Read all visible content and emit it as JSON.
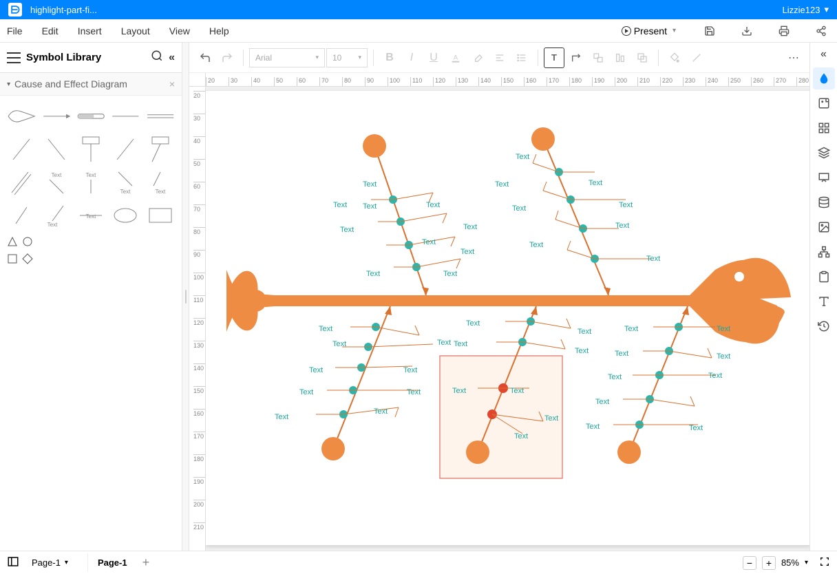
{
  "titlebar": {
    "filename": "highlight-part-fi...",
    "user": "Lizzie123"
  },
  "menubar": {
    "items": [
      "File",
      "Edit",
      "Insert",
      "Layout",
      "View",
      "Help"
    ],
    "present": "Present"
  },
  "left": {
    "title": "Symbol Library",
    "category": "Cause and Effect Diagram",
    "shape_labels": {
      "text": "Text"
    }
  },
  "toolbar": {
    "font": "Arial",
    "size": "10"
  },
  "ruler_h": [
    20,
    30,
    40,
    50,
    60,
    70,
    80,
    90,
    100,
    110,
    120,
    130,
    140,
    150,
    160,
    170,
    180,
    190,
    200,
    210,
    220,
    230,
    240,
    250,
    260,
    270,
    280
  ],
  "ruler_v": [
    20,
    30,
    40,
    50,
    60,
    70,
    80,
    90,
    100,
    110,
    120,
    130,
    140,
    150,
    160,
    170,
    180,
    190,
    200,
    210
  ],
  "diagram": {
    "bone_label": "Text",
    "colors": {
      "fish": "#ee8c44",
      "node": "#2fb4aa",
      "highlight_node": "#e0482e"
    }
  },
  "bottom": {
    "page_dropdown": "Page-1",
    "tab": "Page-1",
    "zoom": "85%"
  }
}
